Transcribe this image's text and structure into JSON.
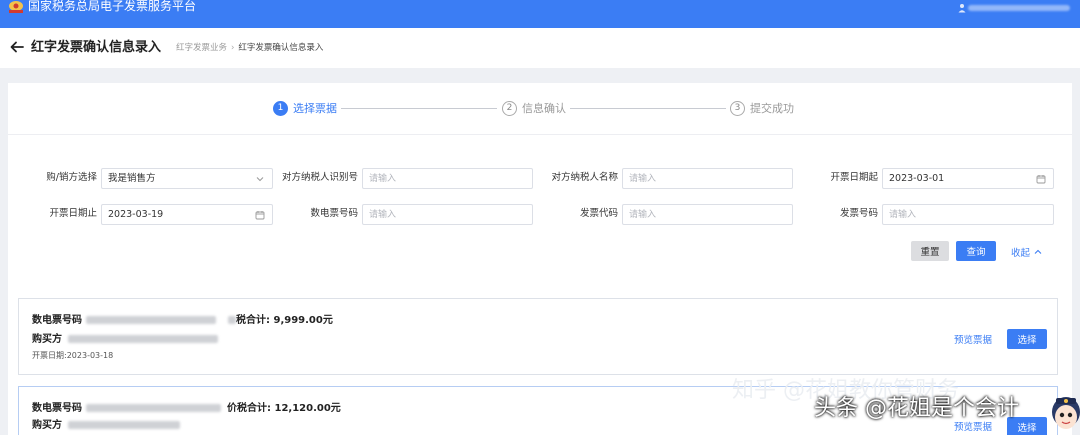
{
  "app": {
    "title": "国家税务总局电子发票服务平台",
    "accent_color": "#3b7df4",
    "logo_icon": "tax-bureau-emblem-icon",
    "user_icon": "user-icon"
  },
  "header": {
    "back_icon": "arrow-left-icon",
    "title": "红字发票确认信息录入",
    "breadcrumb": [
      "红字发票业务",
      "红字发票确认信息录入"
    ]
  },
  "steps": [
    {
      "num": "1",
      "label": "选择票据",
      "state": "active"
    },
    {
      "num": "2",
      "label": "信息确认",
      "state": "todo"
    },
    {
      "num": "3",
      "label": "提交成功",
      "state": "todo"
    }
  ],
  "filters": {
    "role": {
      "label": "购/销方选择",
      "value": "我是销售方",
      "icon": "chevron-down-icon"
    },
    "counterparty_id": {
      "label": "对方纳税人识别号",
      "placeholder": "请输入"
    },
    "counterparty_name": {
      "label": "对方纳税人名称",
      "placeholder": "请输入"
    },
    "date_from": {
      "label": "开票日期起",
      "value": "2023-03-01",
      "icon": "calendar-icon"
    },
    "date_to": {
      "label": "开票日期止",
      "value": "2023-03-19",
      "icon": "calendar-icon"
    },
    "e_invoice_no": {
      "label": "数电票号码",
      "placeholder": "请输入"
    },
    "invoice_code": {
      "label": "发票代码",
      "placeholder": "请输入"
    },
    "invoice_no": {
      "label": "发票号码",
      "placeholder": "请输入"
    }
  },
  "actions": {
    "reset_label": "重置",
    "query_label": "查询",
    "collapse_label": "收起",
    "collapse_icon": "chevron-up-icon"
  },
  "results": [
    {
      "e_invoice_label": "数电票号码",
      "total_label": "税合计:",
      "total_value": "9,999.00元",
      "buyer_label": "购买方",
      "date_label": "开票日期:",
      "date_value": "2023-03-18",
      "preview_label": "预览票据",
      "select_label": "选择"
    },
    {
      "e_invoice_label": "数电票号码",
      "total_label": "价税合计:",
      "total_value": "12,120.00元",
      "buyer_label": "购买方",
      "preview_label": "预览票据",
      "select_label": "选择"
    }
  ],
  "watermarks": {
    "zhihu": "知乎 @花姐教你管财务",
    "toutiao": "头条 @花姐是个会计",
    "avatar_icon": "cartoon-avatar-icon"
  }
}
